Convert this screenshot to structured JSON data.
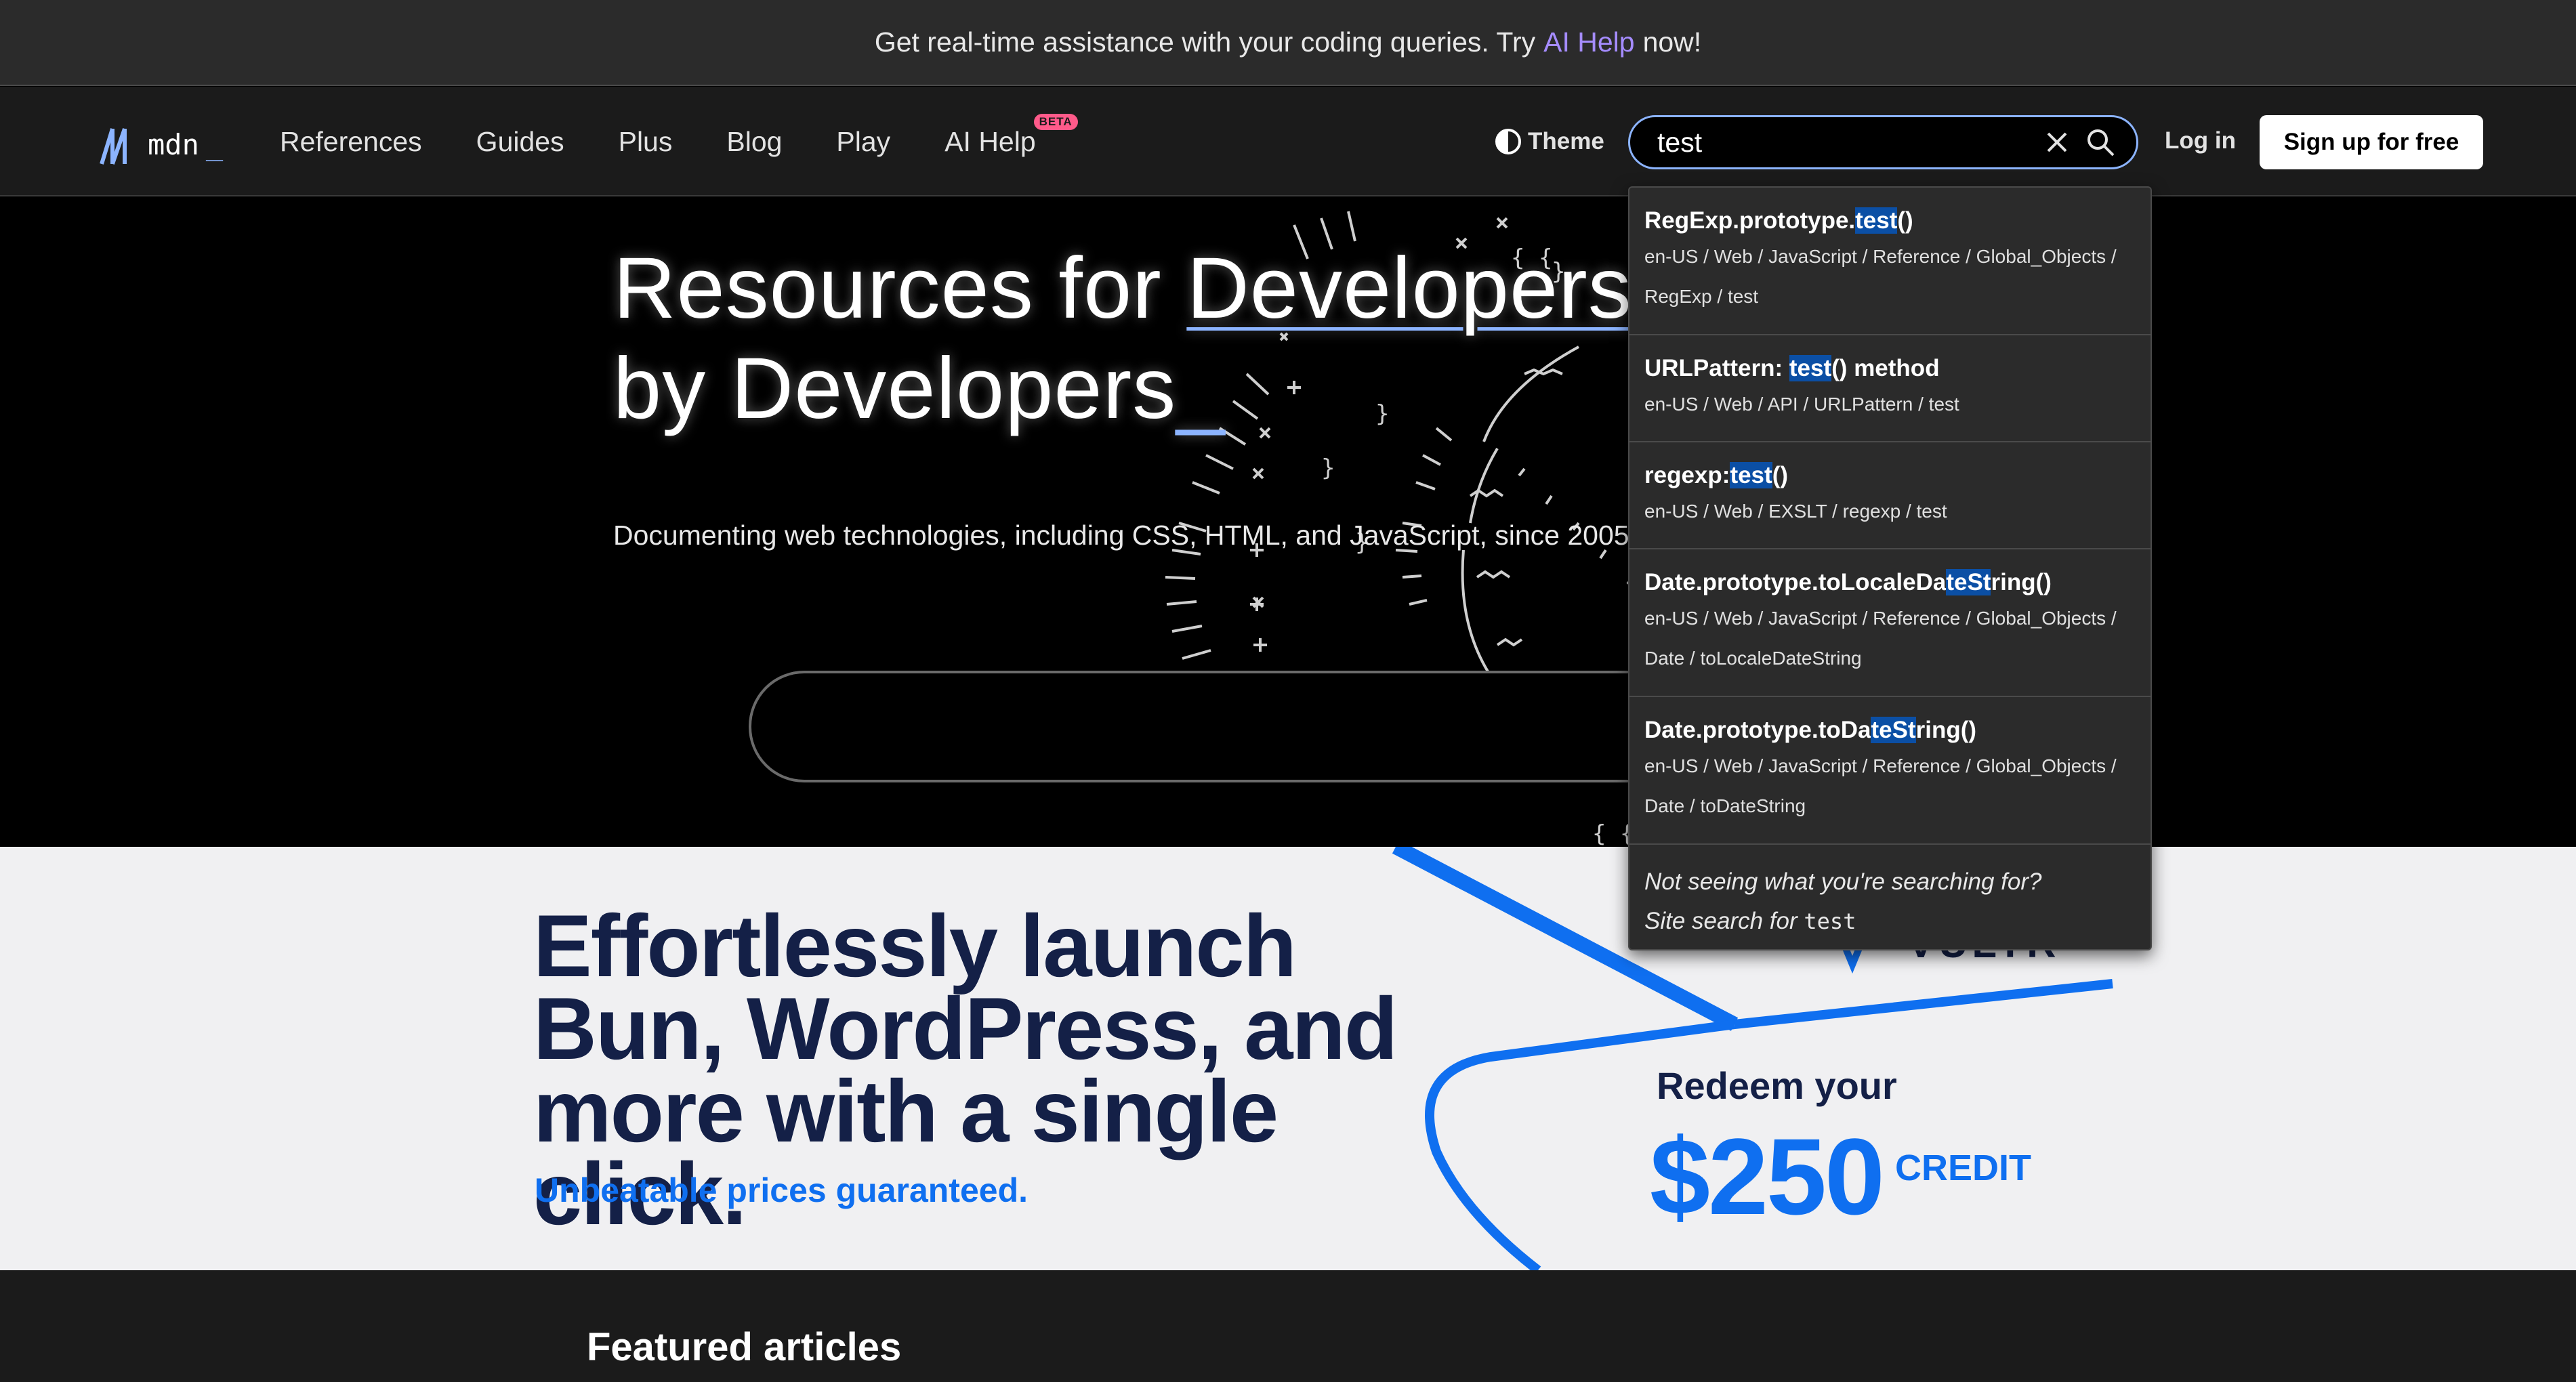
{
  "banner": {
    "text_before": "Get real-time assistance with your coding queries. Try",
    "link": "AI Help",
    "text_after": "now!"
  },
  "nav": {
    "logo_text": "mdn",
    "logo_cursor": "_",
    "links": [
      "References",
      "Guides",
      "Plus",
      "Blog",
      "Play",
      "AI Help"
    ],
    "beta_badge": "BETA",
    "theme_label": "Theme",
    "search_value": "test",
    "login": "Log in",
    "signup": "Sign up for free"
  },
  "hero": {
    "title_line1_pre": "Resources for ",
    "title_line1_ul": "Developers",
    "title_line1_post": ",",
    "title_line2": "by Developers",
    "title_cursor": "_",
    "subtitle": "Documenting web technologies, including CSS, HTML, and JavaScript, since 2005."
  },
  "autocomplete": {
    "results": [
      {
        "pre": "RegExp.prototype.",
        "hl": "test",
        "post": "()",
        "path1": "en-US / Web / JavaScript / Reference / Global_Objects /",
        "path2": "RegExp / test"
      },
      {
        "pre": "URLPattern: ",
        "hl": "test",
        "post": "() method",
        "path1": "en-US / Web / API / URLPattern / test",
        "path2": ""
      },
      {
        "pre": "regexp:",
        "hl": "test",
        "post": "()",
        "path1": "en-US / Web / EXSLT / regexp / test",
        "path2": ""
      },
      {
        "pre": "Date.prototype.toLocaleDa",
        "hl": "teSt",
        "post": "ring()",
        "path1": "en-US / Web / JavaScript / Reference / Global_Objects /",
        "path2": "Date / toLocaleDateString"
      },
      {
        "pre": "Date.prototype.toDa",
        "hl": "teSt",
        "post": "ring()",
        "path1": "en-US / Web / JavaScript / Reference / Global_Objects /",
        "path2": "Date / toDateString"
      }
    ],
    "not_seeing": "Not seeing what you're searching for?",
    "site_search_label": "Site search for",
    "site_search_query": "test"
  },
  "ad": {
    "headline": "Effortlessly launch Bun, WordPress, and more with a single click.",
    "tagline": "Unbeatable prices guaranteed.",
    "redeem": "Redeem your",
    "amount": "$250",
    "credit": "CREDIT",
    "brand_partial": "VULTR"
  },
  "featured": {
    "title": "Featured articles"
  },
  "colors": {
    "accent_blue": "#8cb4ff",
    "ai_purple": "#a58cff",
    "beta_pink": "#ff5a8a",
    "ad_blue": "#0f6ff0",
    "ad_navy": "#142047",
    "highlight": "#0b4fa5"
  }
}
